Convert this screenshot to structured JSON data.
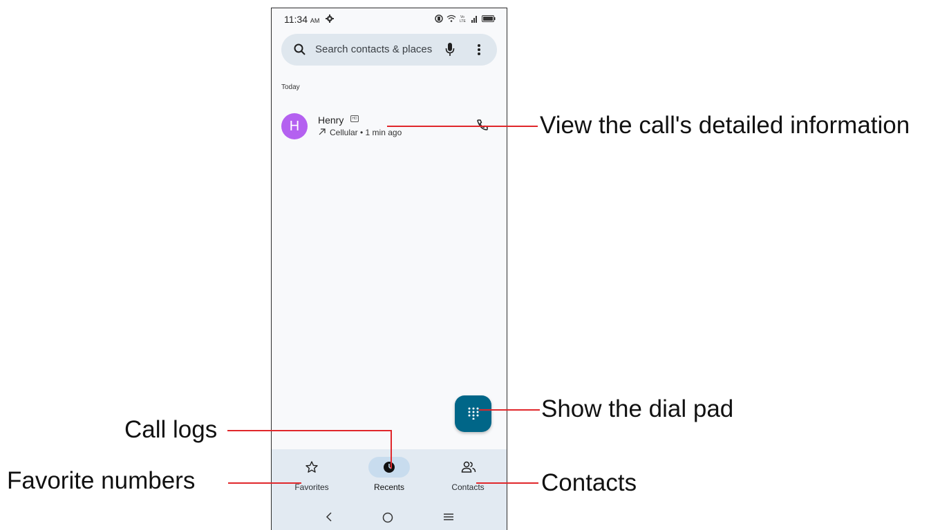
{
  "status_bar": {
    "time": "11:34",
    "ampm": "AM"
  },
  "search": {
    "placeholder": "Search contacts & places"
  },
  "recents": {
    "section_title": "Today",
    "calls": [
      {
        "initial": "H",
        "name": "Henry",
        "detail": "Cellular • 1 min ago",
        "avatar_color": "#b461f0"
      }
    ]
  },
  "bottom_nav": {
    "items": [
      {
        "label": "Favorites",
        "icon": "star-icon"
      },
      {
        "label": "Recents",
        "icon": "clock-icon",
        "active": true
      },
      {
        "label": "Contacts",
        "icon": "people-icon"
      }
    ]
  },
  "annotations": {
    "view_details": "View the call's detailed information",
    "dial_pad": "Show the dial pad",
    "call_logs": "Call logs",
    "favorites": "Favorite numbers",
    "contacts": "Contacts"
  },
  "colors": {
    "accent": "#006688",
    "annotation_line": "#e0262a",
    "nav_bg": "#e2eaf2"
  }
}
